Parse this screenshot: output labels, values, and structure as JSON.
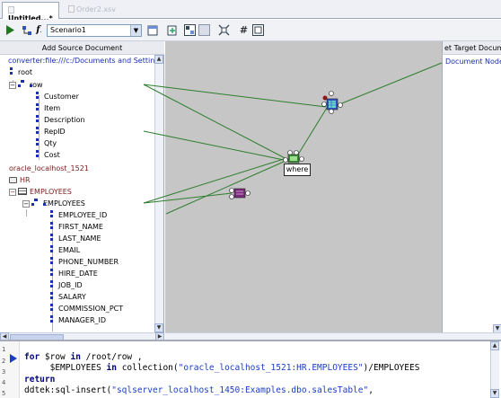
{
  "tabs": [
    {
      "label": "Untitled...*",
      "active": true
    },
    {
      "label": "Order2.xsv",
      "active": false
    }
  ],
  "toolbar": {
    "scenario": "Scenario1",
    "function_label": "f"
  },
  "source": {
    "header": "Add Source Document",
    "converter_path": "converter:file:///c:/Documents and Settings/jpar",
    "root": "root",
    "row": "row",
    "row_fields": [
      "Customer",
      "Item",
      "Description",
      "RepID",
      "Qty",
      "Cost"
    ],
    "db_connection": "oracle_localhost_1521",
    "schema": "HR",
    "table": "EMPLOYEES",
    "table_row": "EMPLOYEES",
    "columns": [
      "EMPLOYEE_ID",
      "FIRST_NAME",
      "LAST_NAME",
      "EMAIL",
      "PHONE_NUMBER",
      "HIRE_DATE",
      "JOB_ID",
      "SALARY",
      "COMMISSION_PCT",
      "MANAGER_ID"
    ]
  },
  "target": {
    "header": "et Target Document",
    "node": "Document Node"
  },
  "canvas": {
    "where_label": "where"
  },
  "code": {
    "line_numbers": [
      "1",
      "2",
      "3",
      "4",
      "5"
    ],
    "line2_kw1": "for",
    "line2_var": " $row ",
    "line2_kw2": "in",
    "line2_rest": " /root/row ,",
    "line3_var": "     $EMPLOYEES ",
    "line3_kw": "in",
    "line3_fn": " collection(",
    "line3_str": "\"oracle_localhost_1521:HR.EMPLOYEES\"",
    "line3_rest": ")/EMPLOYEES",
    "line4": "return",
    "line5_fn": "ddtek:sql-insert(",
    "line5_str": "\"sqlserver_localhost_1450:Examples.dbo.salesTable\"",
    "line5_rest": ","
  },
  "colors": {
    "link_line": "#2d7d2d",
    "canvas_bg": "#c6c6c6",
    "node_blue": "#1a2fb0"
  }
}
